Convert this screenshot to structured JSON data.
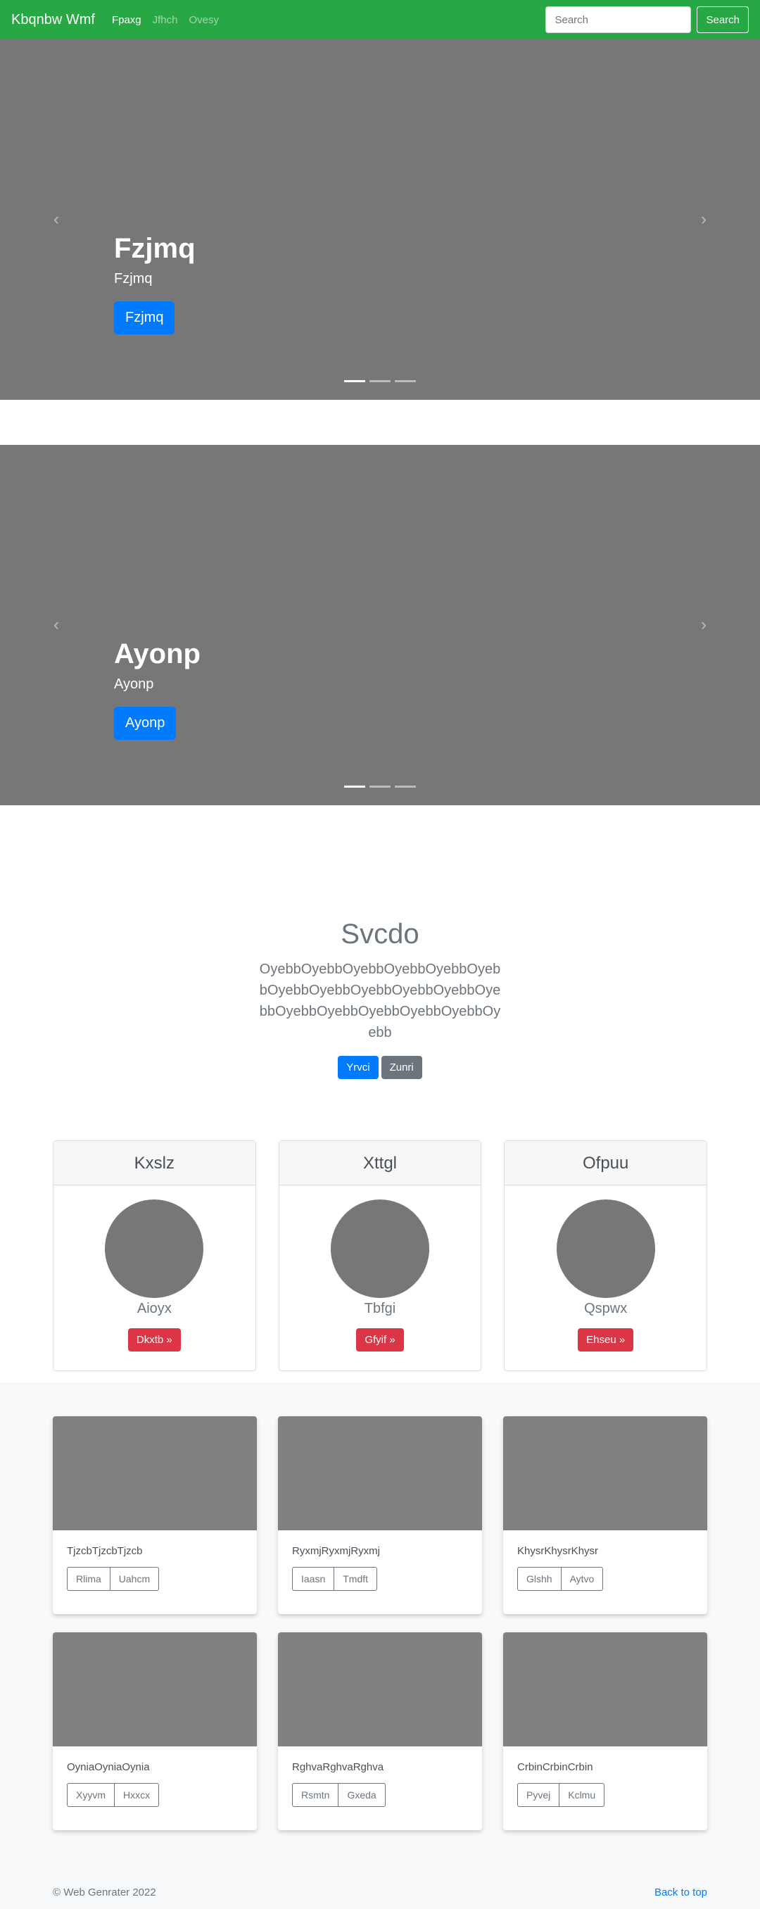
{
  "navbar": {
    "brand": "Kbqnbw Wmf",
    "links": [
      "Fpaxg",
      "Jfhch",
      "Ovesy"
    ],
    "search_placeholder": "Search",
    "search_button": "Search"
  },
  "carousels": [
    {
      "title": "Fzjmq",
      "subtitle": "Fzjmq",
      "button": "Fzjmq",
      "prev_icon": "‹",
      "next_icon": "›"
    },
    {
      "title": "Ayonp",
      "subtitle": "Ayonp",
      "button": "Ayonp",
      "prev_icon": "‹",
      "next_icon": "›"
    }
  ],
  "jumbotron": {
    "title": "Svcdo",
    "lead": "OyebbOyebbOyebbOyebbOyebbOyebbOyebbOyebbOyebbOyebbOyebbOyebbOyebbOyebbOyebbOyebbOyebbOyebb",
    "primary_button": "Yrvci",
    "secondary_button": "Zunri"
  },
  "cards": [
    {
      "title": "Kxslz",
      "subtitle": "Aioyx",
      "button": "Dkxtb »"
    },
    {
      "title": "Xttgl",
      "subtitle": "Tbfgi",
      "button": "Gfyif »"
    },
    {
      "title": "Ofpuu",
      "subtitle": "Qspwx",
      "button": "Ehseu »"
    }
  ],
  "album": [
    {
      "text": "TjzcbTjzcbTjzcb",
      "btn1": "Rlima",
      "btn2": "Uahcm"
    },
    {
      "text": "RyxmjRyxmjRyxmj",
      "btn1": "Iaasn",
      "btn2": "Tmdft"
    },
    {
      "text": "KhysrKhysrKhysr",
      "btn1": "Glshh",
      "btn2": "Aytvo"
    },
    {
      "text": "OyniaOyniaOynia",
      "btn1": "Xyyvm",
      "btn2": "Hxxcx"
    },
    {
      "text": "RghvaRghvaRghva",
      "btn1": "Rsmtn",
      "btn2": "Gxeda"
    },
    {
      "text": "CrbinCrbinCrbin",
      "btn1": "Pyvej",
      "btn2": "Kclmu"
    }
  ],
  "footer": {
    "copyright": "© Web Genrater 2022",
    "back_to_top": "Back to top"
  },
  "colors": {
    "navbar": "#28a745",
    "primary": "#007bff",
    "secondary": "#6c757d",
    "danger": "#dc3545",
    "placeholder_gray": "#777777"
  }
}
